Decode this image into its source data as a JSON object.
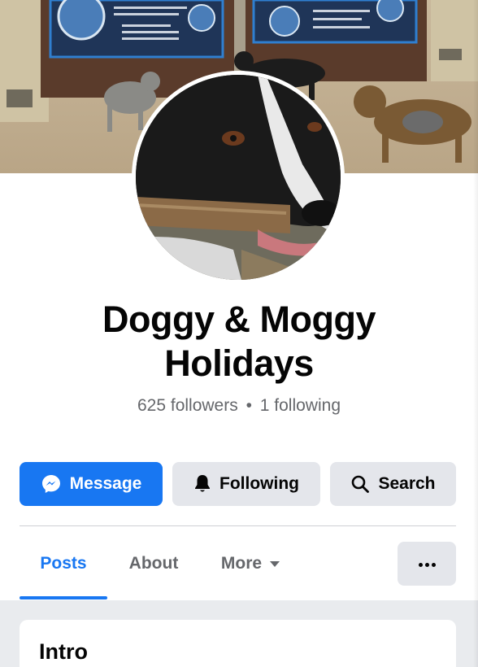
{
  "page": {
    "name": "Doggy & Moggy Holidays",
    "followers": "625 followers",
    "separator": "•",
    "following": "1 following"
  },
  "actions": {
    "message_label": "Message",
    "following_label": "Following",
    "search_label": "Search"
  },
  "tabs": [
    {
      "label": "Posts",
      "active": true
    },
    {
      "label": "About",
      "active": false
    },
    {
      "label": "More",
      "active": false
    }
  ],
  "intro": {
    "title": "Intro"
  },
  "colors": {
    "accent": "#1877f2",
    "secondary_button": "#e4e6eb",
    "muted_text": "#65676b"
  },
  "icons": {
    "message": "messenger-icon",
    "following": "bell-icon",
    "search": "search-icon",
    "more": "ellipsis-icon",
    "dropdown": "caret-down-icon"
  }
}
